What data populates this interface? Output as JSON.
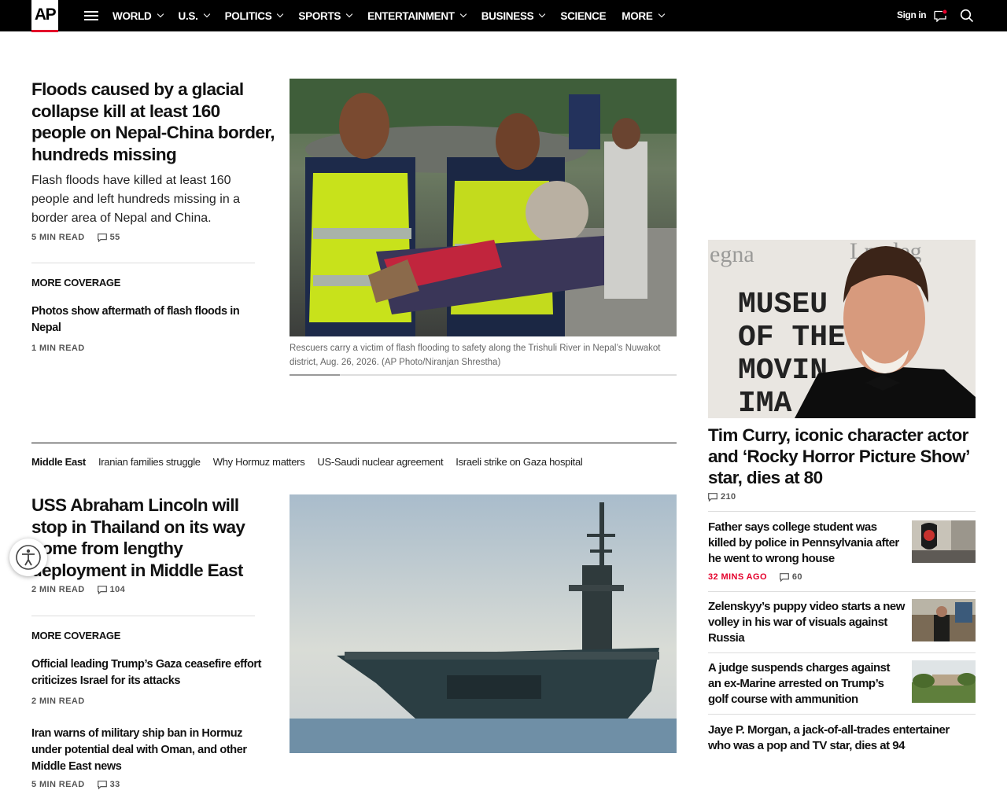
{
  "nav": {
    "logo": "AP",
    "items": [
      {
        "label": "WORLD",
        "dropdown": true
      },
      {
        "label": "U.S.",
        "dropdown": true
      },
      {
        "label": "POLITICS",
        "dropdown": true
      },
      {
        "label": "SPORTS",
        "dropdown": true
      },
      {
        "label": "ENTERTAINMENT",
        "dropdown": true
      },
      {
        "label": "BUSINESS",
        "dropdown": true
      },
      {
        "label": "SCIENCE",
        "dropdown": false
      },
      {
        "label": "MORE",
        "dropdown": true
      }
    ],
    "signin": "Sign in",
    "accent_color": "#e4002b"
  },
  "story1": {
    "title": "Floods caused by a glacial collapse kill at least 160 people on Nepal-China border, hundreds missing",
    "description": "Flash floods have killed at least 160 people and left hundreds missing in a border area of Nepal and China.",
    "read_time": "5 MIN READ",
    "comments": "55",
    "image_caption": "Rescuers carry a victim of flash flooding to safety along the Trishuli River in Nepal’s Nuwakot district, Aug. 26, 2026. (AP Photo/Niranjan Shrestha)",
    "more_coverage_label": "MORE COVERAGE",
    "more_coverage": [
      {
        "title": "Photos show aftermath of flash floods in Nepal",
        "read_time": "1 MIN READ"
      }
    ]
  },
  "tagbar": {
    "first": "Middle East",
    "tags": [
      "Iranian families struggle",
      "Why Hormuz matters",
      "US-Saudi nuclear agreement",
      "Israeli strike on Gaza hospital"
    ]
  },
  "story2": {
    "title": "USS Abraham Lincoln will stop in Thailand on its way home from lengthy deployment in Middle East",
    "read_time": "2 MIN READ",
    "comments": "104",
    "more_coverage_label": "MORE COVERAGE",
    "more_coverage": [
      {
        "title": "Official leading Trump’s Gaza ceasefire effort criticizes Israel for its attacks",
        "read_time": "2 MIN READ"
      },
      {
        "title": "Iran warns of military ship ban in Hormuz under potential deal with Oman, and other Middle East news",
        "read_time": "5 MIN READ",
        "comments": "33"
      }
    ]
  },
  "rail": {
    "lead_title": "Tim Curry, iconic character actor and ‘Rocky Horror Picture Show’ star, dies at 80",
    "lead_comments": "210",
    "items": [
      {
        "title": "Father says college student was killed by police in Pennsylvania after he went to wrong house",
        "time": "32 MINS AGO",
        "comments": "60"
      },
      {
        "title": "Zelenskyy’s puppy video starts a new volley in his war of visuals against Russia"
      },
      {
        "title": "A judge suspends charges against an ex-Marine arrested on Trump’s golf course with ammunition"
      },
      {
        "title": "Jaye P. Morgan, a jack-of-all-trades entertainer who was a pop and TV star, dies at 94"
      }
    ]
  }
}
